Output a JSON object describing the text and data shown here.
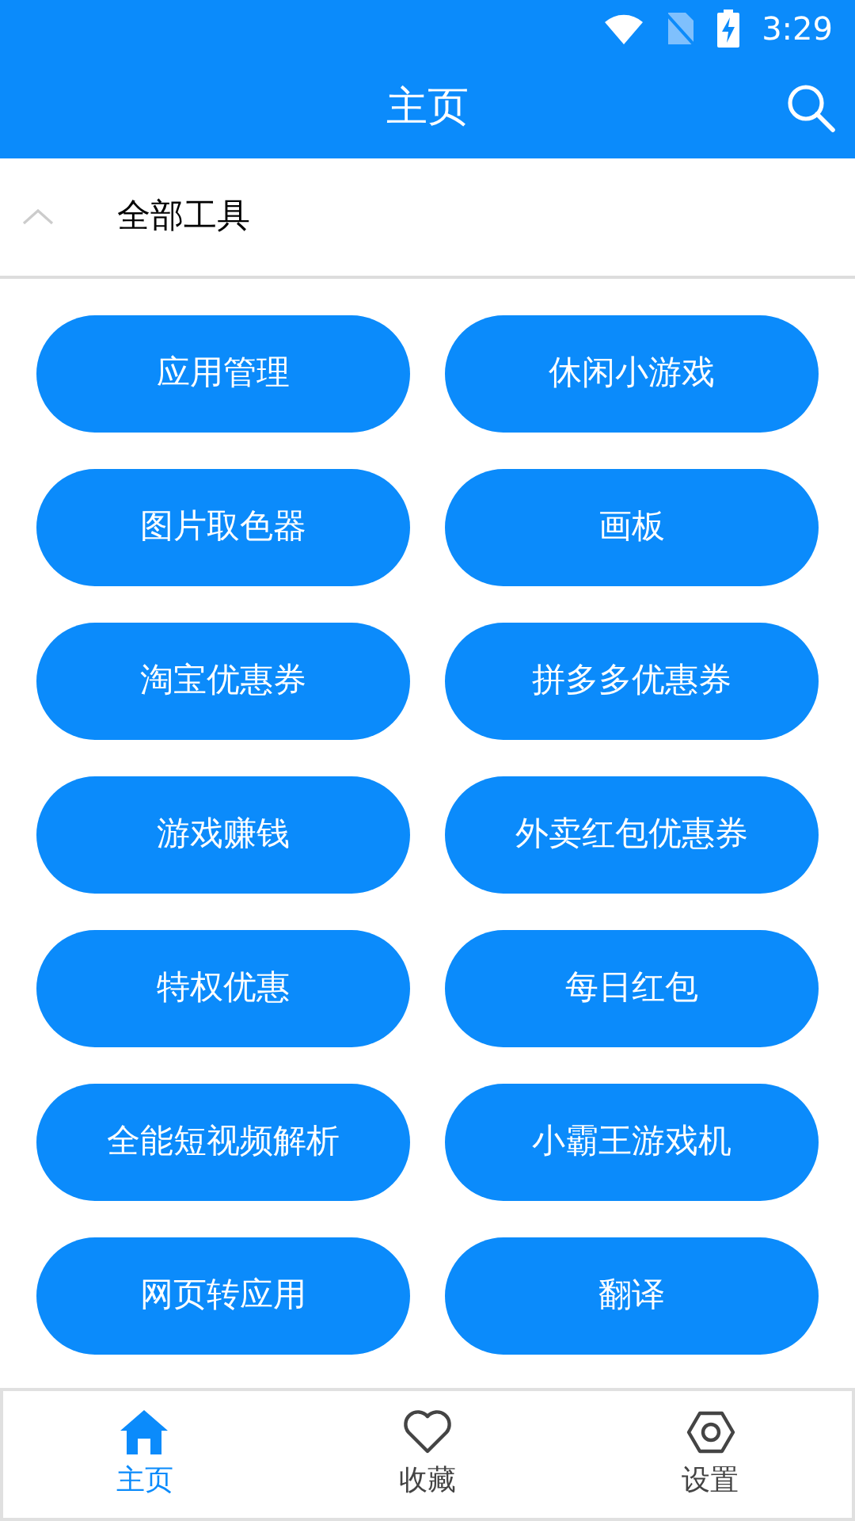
{
  "status_bar": {
    "time": "3:29"
  },
  "header": {
    "title": "主页"
  },
  "section": {
    "title": "全部工具",
    "expanded": true
  },
  "tools": [
    {
      "label": "应用管理"
    },
    {
      "label": "休闲小游戏"
    },
    {
      "label": "图片取色器"
    },
    {
      "label": "画板"
    },
    {
      "label": "淘宝优惠券"
    },
    {
      "label": "拼多多优惠券"
    },
    {
      "label": "游戏赚钱"
    },
    {
      "label": "外卖红包优惠券"
    },
    {
      "label": "特权优惠"
    },
    {
      "label": "每日红包"
    },
    {
      "label": "全能短视频解析"
    },
    {
      "label": "小霸王游戏机"
    },
    {
      "label": "网页转应用"
    },
    {
      "label": "翻译"
    }
  ],
  "bottom_nav": [
    {
      "label": "主页",
      "kind": "home",
      "selected": true
    },
    {
      "label": "收藏",
      "kind": "favorites",
      "selected": false
    },
    {
      "label": "设置",
      "kind": "settings",
      "selected": false
    }
  ]
}
